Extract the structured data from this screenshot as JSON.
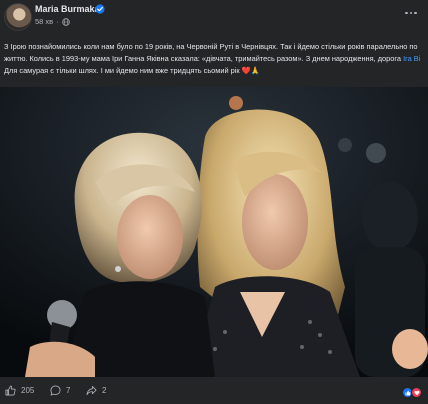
{
  "post": {
    "author": "Maria Burmaka",
    "timestamp": "58 хв",
    "text_segments": {
      "part1": "З Ірою познайомились коли нам було по 19 років, на Червоній Руті в Чернівцях. Так і йдемо стільки років паралельно по життю.  Колись в 1993-му мама Іри Ганна Яківна сказала: «дівчата, тримайтесь разом». З днем народження, дорога ",
      "mention": "Ira Bi",
      "part2": "  Для самурая є тільки шлях. І ми йдемо ним вже тридцять сьомий рік ",
      "emoji": "❤️🙏"
    }
  },
  "engagement": {
    "likes": "205",
    "comments": "7",
    "shares": "2"
  },
  "icons": {
    "verified": "verified-badge-icon",
    "privacy": "globe-icon",
    "more": "more-options-icon",
    "like": "like-thumb-icon",
    "comment": "comment-bubble-icon",
    "share": "share-arrow-icon"
  },
  "colors": {
    "background": "#242526",
    "text": "#e4e6eb",
    "secondary": "#b0b3b8",
    "link": "#4599ff",
    "like_blue": "#1877f2",
    "love_red": "#f33e58"
  }
}
